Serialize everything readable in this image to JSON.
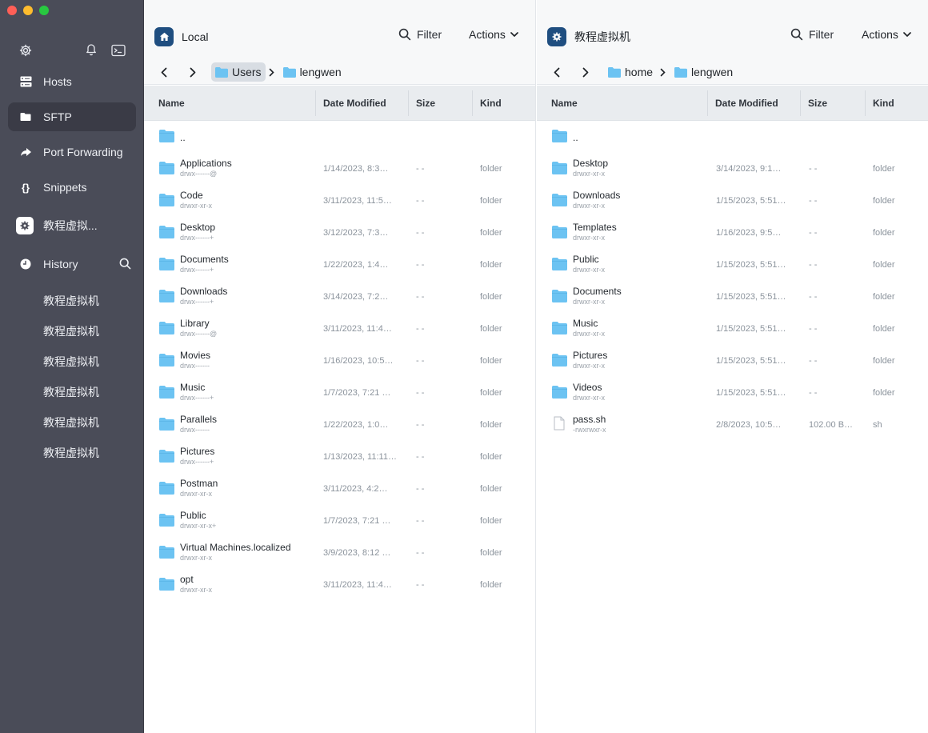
{
  "sidebar": {
    "nav": [
      {
        "label": "Hosts",
        "icon": "hosts-icon"
      },
      {
        "label": "SFTP",
        "icon": "folder-icon"
      },
      {
        "label": "Port Forwarding",
        "icon": "forward-icon"
      },
      {
        "label": "Snippets",
        "icon": "braces-icon"
      },
      {
        "label": "教程虚拟...",
        "icon": "host-icon"
      }
    ],
    "history_label": "History",
    "history": [
      "教程虚拟机",
      "教程虚拟机",
      "教程虚拟机",
      "教程虚拟机",
      "教程虚拟机",
      "教程虚拟机"
    ]
  },
  "left": {
    "title": "Local",
    "filter": "Filter",
    "actions": "Actions",
    "crumbs": [
      "Users",
      "lengwen"
    ],
    "columns": {
      "name": "Name",
      "date": "Date Modified",
      "size": "Size",
      "kind": "Kind"
    },
    "rows": [
      {
        "name": "..",
        "perm": "",
        "date": "",
        "size": "",
        "kind": ""
      },
      {
        "name": "Applications",
        "perm": "drwx------@",
        "date": "1/14/2023, 8:3…",
        "size": "- -",
        "kind": "folder"
      },
      {
        "name": "Code",
        "perm": "drwxr-xr-x",
        "date": "3/11/2023, 11:5…",
        "size": "- -",
        "kind": "folder"
      },
      {
        "name": "Desktop",
        "perm": "drwx------+",
        "date": "3/12/2023, 7:3…",
        "size": "- -",
        "kind": "folder"
      },
      {
        "name": "Documents",
        "perm": "drwx------+",
        "date": "1/22/2023, 1:4…",
        "size": "- -",
        "kind": "folder"
      },
      {
        "name": "Downloads",
        "perm": "drwx------+",
        "date": "3/14/2023, 7:2…",
        "size": "- -",
        "kind": "folder"
      },
      {
        "name": "Library",
        "perm": "drwx------@",
        "date": "3/11/2023, 11:4…",
        "size": "- -",
        "kind": "folder"
      },
      {
        "name": "Movies",
        "perm": "drwx------",
        "date": "1/16/2023, 10:5…",
        "size": "- -",
        "kind": "folder"
      },
      {
        "name": "Music",
        "perm": "drwx------+",
        "date": "1/7/2023, 7:21 …",
        "size": "- -",
        "kind": "folder"
      },
      {
        "name": "Parallels",
        "perm": "drwx------",
        "date": "1/22/2023, 1:0…",
        "size": "- -",
        "kind": "folder"
      },
      {
        "name": "Pictures",
        "perm": "drwx------+",
        "date": "1/13/2023, 11:11…",
        "size": "- -",
        "kind": "folder"
      },
      {
        "name": "Postman",
        "perm": "drwxr-xr-x",
        "date": "3/11/2023, 4:2…",
        "size": "- -",
        "kind": "folder"
      },
      {
        "name": "Public",
        "perm": "drwxr-xr-x+",
        "date": "1/7/2023, 7:21 …",
        "size": "- -",
        "kind": "folder"
      },
      {
        "name": "Virtual Machines.localized",
        "perm": "drwxr-xr-x",
        "date": "3/9/2023, 8:12 …",
        "size": "- -",
        "kind": "folder"
      },
      {
        "name": "opt",
        "perm": "drwxr-xr-x",
        "date": "3/11/2023, 11:4…",
        "size": "- -",
        "kind": "folder"
      }
    ]
  },
  "right": {
    "title": "教程虚拟机",
    "filter": "Filter",
    "actions": "Actions",
    "crumbs": [
      "home",
      "lengwen"
    ],
    "columns": {
      "name": "Name",
      "date": "Date Modified",
      "size": "Size",
      "kind": "Kind"
    },
    "rows": [
      {
        "name": "..",
        "perm": "",
        "date": "",
        "size": "",
        "kind": ""
      },
      {
        "name": "Desktop",
        "perm": "drwxr-xr-x",
        "date": "3/14/2023, 9:1…",
        "size": "- -",
        "kind": "folder"
      },
      {
        "name": "Downloads",
        "perm": "drwxr-xr-x",
        "date": "1/15/2023, 5:51…",
        "size": "- -",
        "kind": "folder"
      },
      {
        "name": "Templates",
        "perm": "drwxr-xr-x",
        "date": "1/16/2023, 9:5…",
        "size": "- -",
        "kind": "folder"
      },
      {
        "name": "Public",
        "perm": "drwxr-xr-x",
        "date": "1/15/2023, 5:51…",
        "size": "- -",
        "kind": "folder"
      },
      {
        "name": "Documents",
        "perm": "drwxr-xr-x",
        "date": "1/15/2023, 5:51…",
        "size": "- -",
        "kind": "folder"
      },
      {
        "name": "Music",
        "perm": "drwxr-xr-x",
        "date": "1/15/2023, 5:51…",
        "size": "- -",
        "kind": "folder"
      },
      {
        "name": "Pictures",
        "perm": "drwxr-xr-x",
        "date": "1/15/2023, 5:51…",
        "size": "- -",
        "kind": "folder"
      },
      {
        "name": "Videos",
        "perm": "drwxr-xr-x",
        "date": "1/15/2023, 5:51…",
        "size": "- -",
        "kind": "folder"
      },
      {
        "name": "pass.sh",
        "perm": "-rwxrwxr-x",
        "date": "2/8/2023, 10:5…",
        "size": "102.00 B…",
        "kind": "sh",
        "file": true
      }
    ]
  }
}
